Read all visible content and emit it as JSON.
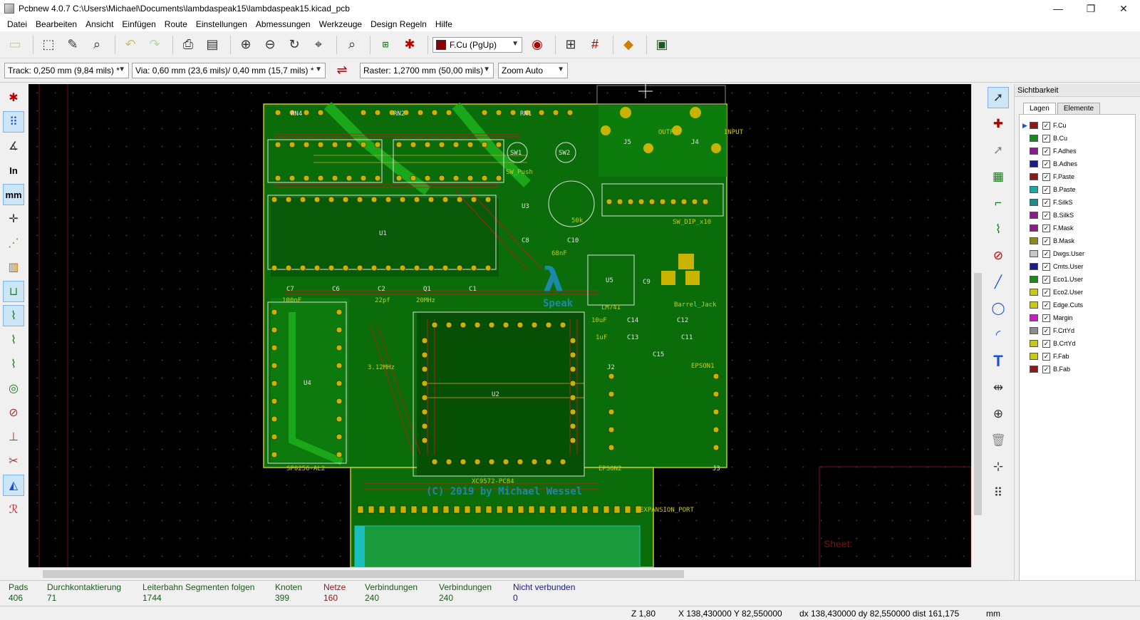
{
  "window": {
    "title": "Pcbnew 4.0.7 C:\\Users\\Michael\\Documents\\lambdaspeak15\\lambdaspeak15.kicad_pcb",
    "minimize": "—",
    "maximize": "❐",
    "close": "✕"
  },
  "menu": [
    "Datei",
    "Bearbeiten",
    "Ansicht",
    "Einfügen",
    "Route",
    "Einstellungen",
    "Abmessungen",
    "Werkzeuge",
    "Design Regeln",
    "Hilfe"
  ],
  "toolbar": {
    "layer_select": "F.Cu (PgUp)",
    "layer_color": "#8b0000",
    "track_width": "Track: 0,250 mm (9,84 mils) *",
    "via_size": "Via: 0,60 mm (23,6 mils)/ 0,40 mm (15,7 mils) *",
    "grid": "Raster: 1,2700 mm (50,00 mils)",
    "zoom": "Zoom Auto"
  },
  "pcb": {
    "silk_labels": [
      "RN4",
      "RN2",
      "RN1",
      "SW1",
      "SW2",
      "SW_Push",
      "U3",
      "50k",
      "U1",
      "U2",
      "U4",
      "U5",
      "C7",
      "C6",
      "C2",
      "Q1",
      "C1",
      "C8",
      "C10",
      "C14",
      "C12",
      "C13",
      "C11",
      "C15",
      "C9",
      "XC9572-PC84",
      "SP0256-AL2",
      "LM741",
      "Barrel_Jack",
      "EPSON1",
      "EPSON2",
      "J2",
      "J3",
      "J4",
      "J5",
      "OUTPUT",
      "INPUT",
      "SW_DIP_x10",
      "Speak",
      "100nF",
      "22pf",
      "20MHz",
      "3.12MHz",
      "10uF",
      "1uF",
      "68nF",
      "EXPANSION_PORT",
      "Sheet:"
    ],
    "copyright": "(C) 2019 by Michael Wessel"
  },
  "panel": {
    "title": "Sichtbarkeit",
    "tabs": [
      "Lagen",
      "Elemente"
    ],
    "layers": [
      {
        "name": "F.Cu",
        "color": "#8b1a1a"
      },
      {
        "name": "B.Cu",
        "color": "#1a8b1a"
      },
      {
        "name": "F.Adhes",
        "color": "#8b1a8b"
      },
      {
        "name": "B.Adhes",
        "color": "#1a1a8b"
      },
      {
        "name": "F.Paste",
        "color": "#8b1a1a"
      },
      {
        "name": "B.Paste",
        "color": "#1aa8a8"
      },
      {
        "name": "F.SilkS",
        "color": "#1a8b8b"
      },
      {
        "name": "B.SilkS",
        "color": "#8b1a8b"
      },
      {
        "name": "F.Mask",
        "color": "#8b1a8b"
      },
      {
        "name": "B.Mask",
        "color": "#8b8b1a"
      },
      {
        "name": "Dwgs.User",
        "color": "#c8c8c8"
      },
      {
        "name": "Cmts.User",
        "color": "#1a1a8b"
      },
      {
        "name": "Eco1.User",
        "color": "#1a8b1a"
      },
      {
        "name": "Eco2.User",
        "color": "#c8c81a"
      },
      {
        "name": "Edge.Cuts",
        "color": "#c8c81a"
      },
      {
        "name": "Margin",
        "color": "#c81ac8"
      },
      {
        "name": "F.CrtYd",
        "color": "#8c8c8c"
      },
      {
        "name": "B.CrtYd",
        "color": "#c8c81a"
      },
      {
        "name": "F.Fab",
        "color": "#c8c81a"
      },
      {
        "name": "B.Fab",
        "color": "#8b1a1a"
      }
    ]
  },
  "status": {
    "pads_label": "Pads",
    "pads_value": "406",
    "vias_label": "Durchkontaktierung",
    "vias_value": "71",
    "tracks_label": "Leiterbahn Segmenten folgen",
    "tracks_value": "1744",
    "nodes_label": "Knoten",
    "nodes_value": "399",
    "nets_label": "Netze",
    "nets_value": "160",
    "conn1_label": "Verbindungen",
    "conn1_value": "240",
    "conn2_label": "Verbindungen",
    "conn2_value": "240",
    "unrouted_label": "Nicht verbunden",
    "unrouted_value": "0"
  },
  "coords": {
    "zoom": "Z 1,80",
    "xy": "X 138,430000  Y 82,550000",
    "delta": "dx 138,430000  dy 82,550000  dist 161,175",
    "units": "mm"
  }
}
